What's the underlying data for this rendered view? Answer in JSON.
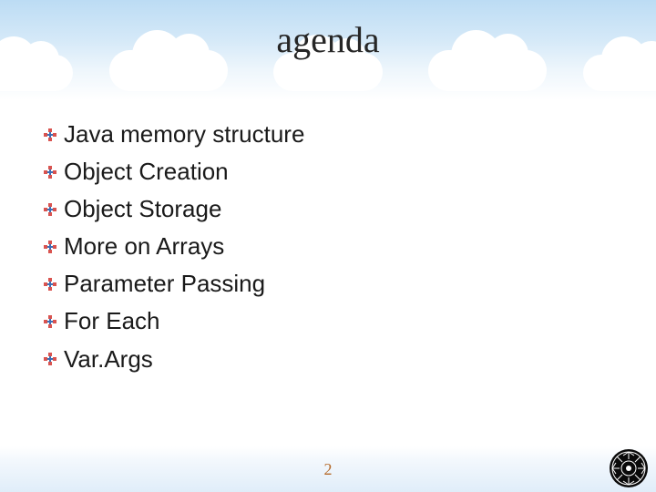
{
  "title": "agenda",
  "bullets": [
    "Java memory structure",
    "Object Creation",
    "Object Storage",
    "More on Arrays",
    "Parameter Passing",
    "For Each",
    "Var.Args"
  ],
  "page_number": "2"
}
